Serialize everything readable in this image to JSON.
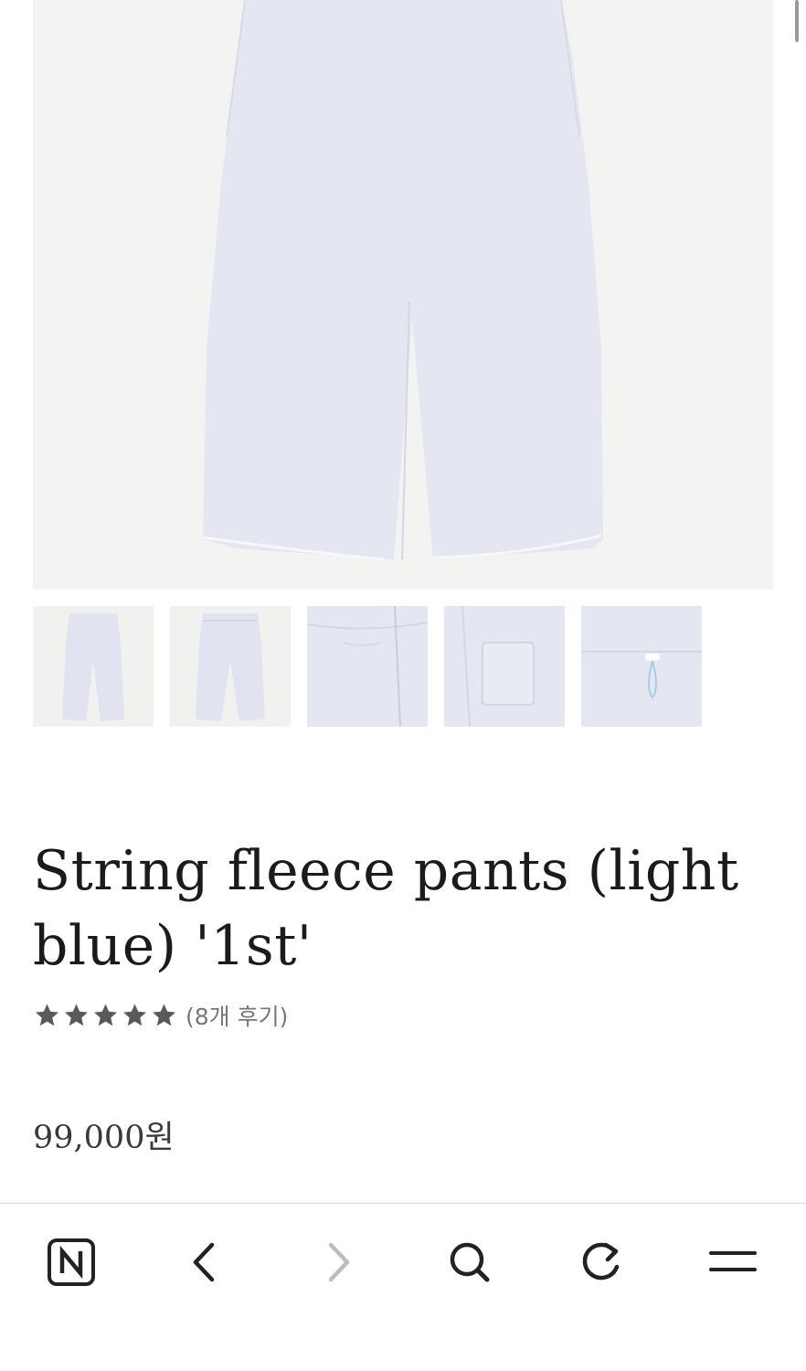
{
  "product": {
    "title": "String fleece pants (light blue) '1st'",
    "rating": 5,
    "review_count_label": "(8개 후기)",
    "price": "99,000원"
  },
  "thumbnails": [
    "front",
    "front",
    "waist-detail",
    "back-pocket",
    "drawstring"
  ],
  "colors": {
    "fabric": "#e4e7f2",
    "accent_string": "#a9cbe6",
    "star": "#595959",
    "text": "#1b1b1b"
  },
  "bottom_nav": {
    "items": [
      "naver-home-icon",
      "back-icon",
      "forward-icon",
      "search-icon",
      "refresh-icon",
      "menu-icon"
    ]
  }
}
